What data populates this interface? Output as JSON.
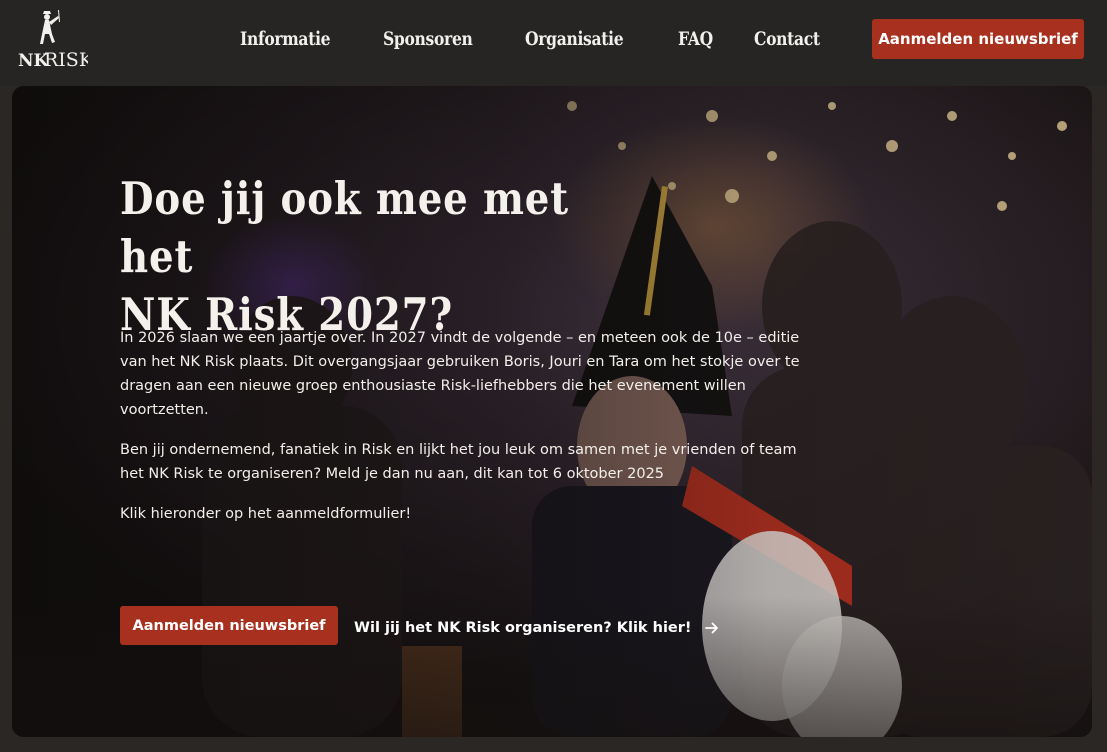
{
  "logo": {
    "text_nk": "NK",
    "text_risk": "RISK"
  },
  "nav": {
    "items": [
      {
        "label": "Informatie"
      },
      {
        "label": "Sponsoren"
      },
      {
        "label": "Organisatie"
      },
      {
        "label": "FAQ"
      },
      {
        "label": "Contact"
      }
    ],
    "newsletter_button": "Aanmelden nieuwsbrief"
  },
  "hero": {
    "title_line1": "Doe jij ook mee met het",
    "title_line2": "NK Risk 2027?",
    "paragraph1": "In 2026 slaan we een jaartje over. In 2027 vindt de volgende – en meteen ook de 10e – editie van het NK Risk plaats. Dit overgangsjaar gebruiken Boris, Jouri en Tara om het stokje over te dragen aan een nieuwe groep enthousiaste Risk-liefhebbers die het evenement willen voortzetten.",
    "paragraph2": "Ben jij ondernemend, fanatiek in Risk en lijkt het jou leuk om samen met je vrienden of team het NK Risk te organiseren? Meld je dan nu aan, dit kan tot 6 oktober 2025",
    "paragraph3": "Klik hieronder op het aanmeldformulier!",
    "primary_button": "Aanmelden nieuwsbrief",
    "secondary_link": "Wil jij het NK Risk organiseren? Klik hier!"
  },
  "colors": {
    "accent": "#a8301f",
    "header_bg": "#272524",
    "text": "#ffffff"
  },
  "icons": {
    "logo": "soldier-logo-icon",
    "link_arrow": "arrow-right-icon"
  }
}
